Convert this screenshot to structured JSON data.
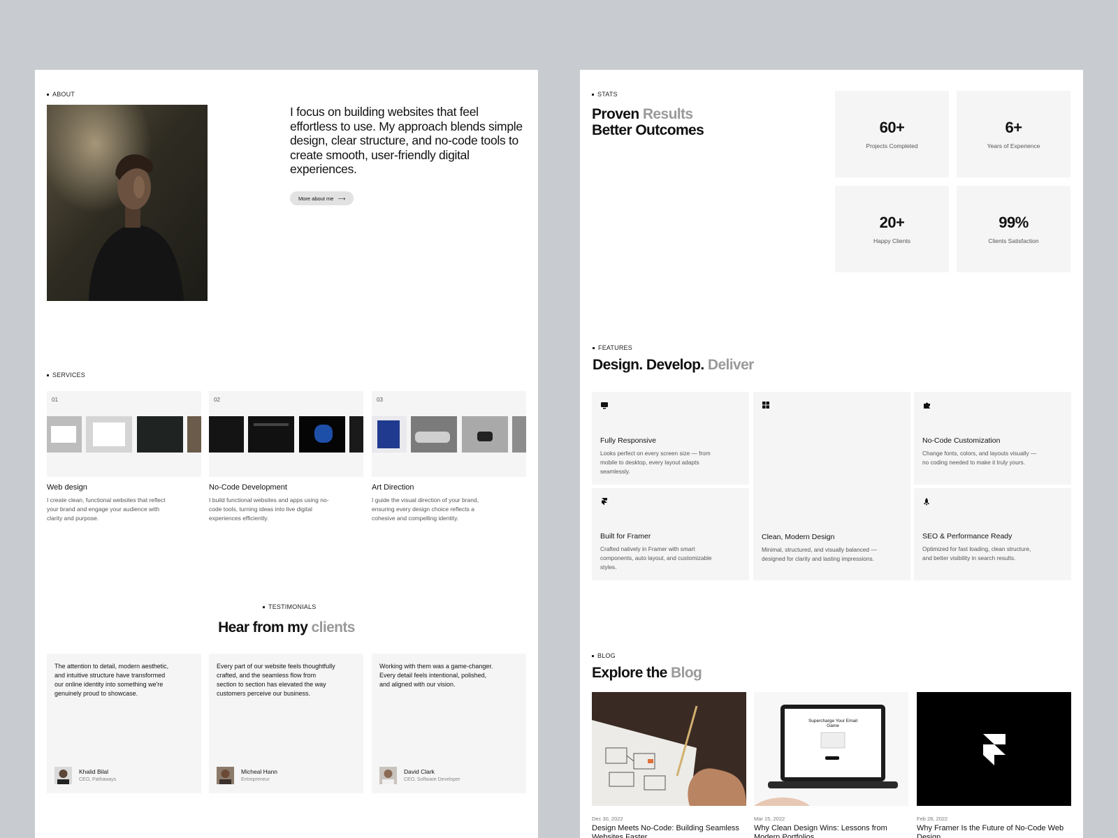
{
  "about": {
    "section_label": "ABOUT",
    "statement": "I focus on building websites that feel effortless to use. My approach blends simple design, clear structure, and no-code tools to create smooth, user-friendly digital experiences.",
    "button_label": "More about me"
  },
  "services": {
    "section_label": "SERVICES",
    "items": [
      {
        "number": "01",
        "title": "Web design",
        "description": "I create clean, functional websites that reflect your brand and engage your audience with clarity and purpose."
      },
      {
        "number": "02",
        "title": "No-Code Development",
        "description": "I build functional websites and apps using no-code tools, turning ideas into live digital experiences efficiently."
      },
      {
        "number": "03",
        "title": "Art Direction",
        "description": "I guide the visual direction of your brand, ensuring every design choice reflects a cohesive and compelling identity."
      }
    ]
  },
  "testimonials": {
    "section_label": "TESTIMONIALS",
    "heading_main": "Hear from my",
    "heading_accent": "clients",
    "items": [
      {
        "quote": "The attention to detail, modern aesthetic, and intuitive structure have transformed our online identity into something we're genuinely proud to showcase.",
        "name": "Khalid Bilal",
        "role": "CEO, Pathaways"
      },
      {
        "quote": "Every part of our website feels thoughtfully crafted, and the seamless flow from section to section has elevated the way customers perceive our business.",
        "name": "Micheal Hann",
        "role": "Entrepreneur"
      },
      {
        "quote": "Working with them was a game-changer. Every detail feels intentional, polished, and aligned with our vision.",
        "name": "David Clark",
        "role": "CEO, Software Developer"
      }
    ]
  },
  "stats": {
    "section_label": "STATS",
    "heading_line1_main": "Proven",
    "heading_line1_accent": "Results",
    "heading_line2": "Better Outcomes",
    "items": [
      {
        "value": "60+",
        "caption": "Projects Completed"
      },
      {
        "value": "6+",
        "caption": "Years of Experience"
      },
      {
        "value": "20+",
        "caption": "Happy Clients"
      },
      {
        "value": "99%",
        "caption": "Clients Satisfaction"
      }
    ]
  },
  "features": {
    "section_label": "FEATURES",
    "heading_main": "Design. Develop.",
    "heading_accent": "Deliver",
    "items": [
      {
        "icon": "monitor-icon",
        "title": "Fully Responsive",
        "description": "Looks perfect on every screen size — from mobile to desktop, every layout adapts seamlessly."
      },
      {
        "icon": "grid-icon",
        "title": "Clean, Modern Design",
        "description": "Minimal, structured, and visually balanced — designed for clarity and lasting impressions."
      },
      {
        "icon": "puzzle-icon",
        "title": "No-Code Customization",
        "description": "Change fonts, colors, and layouts visually — no coding needed to make it truly yours."
      },
      {
        "icon": "framer-icon",
        "title": "Built for Framer",
        "description": "Crafted natively in Framer with smart components, auto layout, and customizable styles."
      },
      {
        "icon": "rocket-icon",
        "title": "SEO & Performance Ready",
        "description": "Optimized for fast loading, clean structure, and better visibility in search results."
      }
    ]
  },
  "blog": {
    "section_label": "BLOG",
    "heading_main": "Explore the",
    "heading_accent": "Blog",
    "mock_headline": "Supercharge Your Email Game",
    "posts": [
      {
        "date": "Dec 30, 2022",
        "title": "Design Meets No-Code: Building Seamless Websites Faster"
      },
      {
        "date": "Mar 15, 2022",
        "title": "Why Clean Design Wins: Lessons from Modern Portfolios"
      },
      {
        "date": "Feb 28, 2022",
        "title": "Why Framer Is the Future of No-Code Web Design"
      }
    ]
  },
  "colors": {
    "page_bg": "#c8cbcf",
    "panel_bg": "#ffffff",
    "card_bg": "#f5f5f5",
    "accent_muted": "#9a9a9a"
  }
}
